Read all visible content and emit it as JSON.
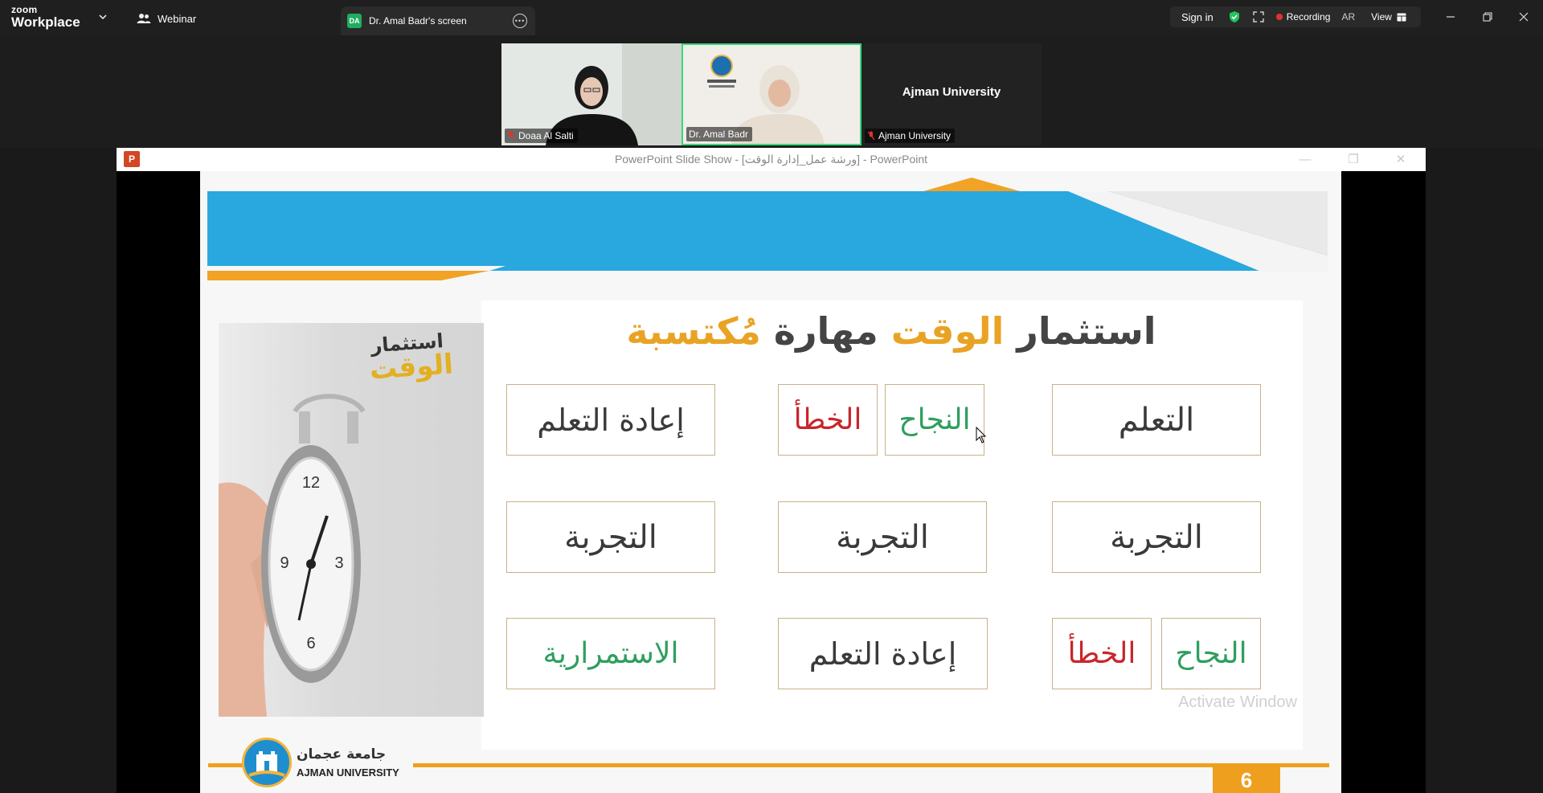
{
  "app": {
    "logo_line1": "zoom",
    "logo_line2": "Workplace",
    "webinar_label": "Webinar",
    "screen_tab": {
      "badge": "DA",
      "label": "Dr. Amal Badr's screen"
    },
    "signin": "Sign in",
    "recording": "Recording",
    "language": "AR",
    "view": "View"
  },
  "participants": [
    {
      "name": "Doaa Al Salti",
      "muted": true
    },
    {
      "name": "Dr. Amal Badr",
      "muted": false,
      "active_speaker": true
    },
    {
      "name": "Ajman University",
      "muted": true,
      "display_name": "Ajman University"
    }
  ],
  "powerpoint": {
    "window_title": "PowerPoint Slide Show - [ورشة عمل_إدارة الوقت] - PowerPoint",
    "icon_letter": "P"
  },
  "slide": {
    "title_part1": "استثمار",
    "title_part2": "الوقت",
    "title_part3": "مهارة",
    "title_part4": "مُكتسبة",
    "photo_caption_small": "استثمار",
    "photo_caption_big": "الوقت",
    "boxes": {
      "r1c1": "التعلم",
      "r1c2a": "النجاح",
      "r1c2b": "الخطأ",
      "r1c3": "إعادة التعلم",
      "r2c1": "التجربة",
      "r2c2": "التجربة",
      "r2c3": "التجربة",
      "r3c1a": "النجاح",
      "r3c1b": "الخطأ",
      "r3c2": "إعادة التعلم",
      "r3c3": "الاستمرارية"
    },
    "university_ar": "جامعة عجمان",
    "university_en": "AJMAN UNIVERSITY",
    "page_number": "6",
    "watermark": "Activate Window"
  },
  "colors": {
    "banner": "#29a8e0",
    "accent_gold": "#e9a324",
    "green": "#2f9e5f",
    "red": "#c8262b",
    "active_speaker_border": "#37d67a"
  }
}
